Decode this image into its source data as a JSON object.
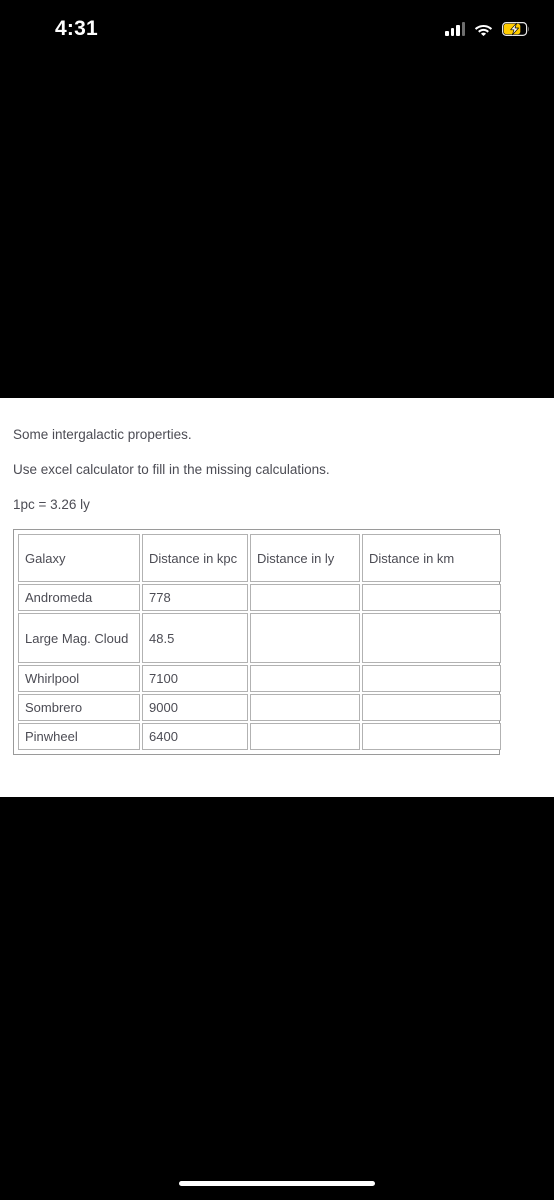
{
  "status_bar": {
    "time": "4:31",
    "icons": {
      "signal": "cellular-signal-icon",
      "wifi": "wifi-icon",
      "battery": "battery-charging-icon"
    },
    "colors": {
      "battery_fill": "#ffcc00",
      "text": "#ffffff",
      "background": "#000000"
    }
  },
  "document": {
    "line_1": "Some intergalactic properties.",
    "line_2": "Use excel calculator to fill in the missing calculations.",
    "line_3": "1pc = 3.26 ly",
    "text_color": "#4c4c54",
    "background": "#ffffff"
  },
  "table": {
    "headers": [
      "Galaxy",
      "Distance in kpc",
      "Distance in ly",
      "Distance in km"
    ],
    "rows": [
      {
        "galaxy": "Andromeda",
        "kpc": "778",
        "ly": "",
        "km": ""
      },
      {
        "galaxy": "Large Mag. Cloud",
        "kpc": "48.5",
        "ly": "",
        "km": ""
      },
      {
        "galaxy": "Whirlpool",
        "kpc": "7100",
        "ly": "",
        "km": ""
      },
      {
        "galaxy": "Sombrero",
        "kpc": "9000",
        "ly": "",
        "km": ""
      },
      {
        "galaxy": "Pinwheel",
        "kpc": "6400",
        "ly": "",
        "km": ""
      }
    ],
    "border_color": "#b2b2b2"
  },
  "home_indicator": {
    "name": "home-indicator-bar",
    "color": "#ffffff"
  }
}
